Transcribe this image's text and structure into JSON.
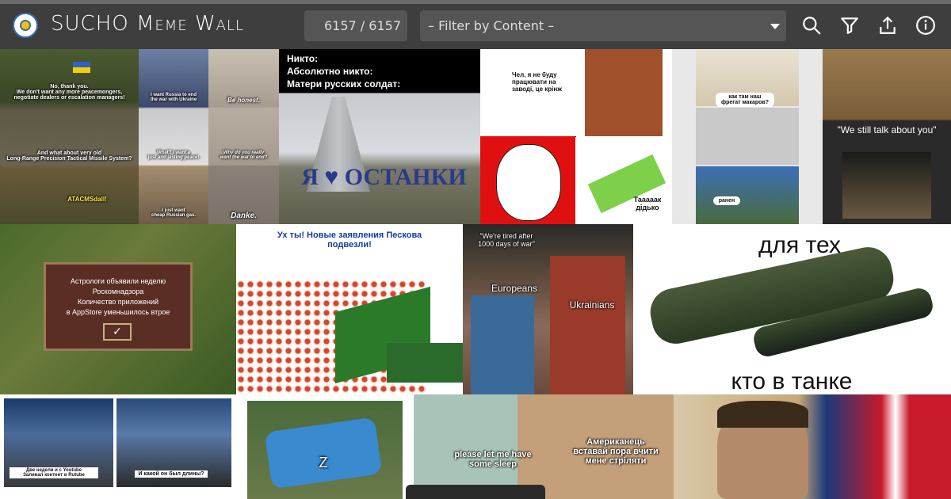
{
  "header": {
    "title": "SUCHO Meme Wall",
    "counter": "6157 / 6157",
    "filter_placeholder": "– Filter by Content –"
  },
  "memes": {
    "m1": [
      "No, thank you.\nWe don't want any more peacemongers,\nnegotiate dealers or escalation managers!",
      "And what about very old\nLong-Range Precision Tactical Missile System?",
      "ATACMSdall!"
    ],
    "m2": [
      "I want Russia to end\nthe war with Ukraine",
      "Be honest.",
      "What? I want a\njust and lasting peace!",
      "Why do you really\nwant the war to end?",
      "I just want\ncheap Russian gas.",
      "Danke."
    ],
    "m3": [
      "Никто:\nАбсолютно никто:\nМатери русских солдат:",
      "Я ♥ ОСТАНКИ"
    ],
    "m4": [
      "Чел, я не буду\nпрацювати на\nзаводі, це крінж",
      "Таааaак\nдідько"
    ],
    "m5": [
      "как там наш\nфрегат макаров?",
      "ранен"
    ],
    "m6": [
      "\"We still talk about you\""
    ],
    "m7": [
      "Астрологи объявили неделю\nРоскомнадзора\nКоличество приложений\nв AppStore уменьшилось втрое"
    ],
    "m8": [
      "Ух ты! Новые заявления Пескова\nподвезли!"
    ],
    "m9": [
      "\"We're tired after\n1000 days of war\"",
      "Europeans",
      "Ukrainians"
    ],
    "m10": [
      "для тех",
      "кто в танке"
    ],
    "m11": [
      "Две недели и с Youtube\nЗаливал контент в Rutube",
      "И какой он был длины?"
    ],
    "m12": [
      "Z"
    ],
    "m13": [
      "please let me have\nsome sleep",
      "Американець\nвставай пора вчити\nмене стріляти"
    ]
  }
}
